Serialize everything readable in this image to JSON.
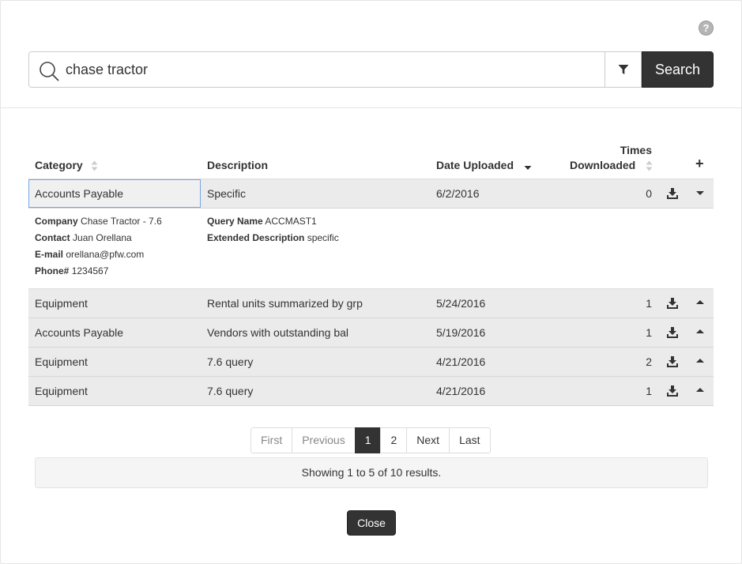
{
  "help": {
    "label": "?"
  },
  "search": {
    "value": "chase tractor",
    "button_label": "Search"
  },
  "table": {
    "headers": {
      "category": "Category",
      "description": "Description",
      "date_uploaded": "Date Uploaded",
      "times_line1": "Times",
      "times_line2": "Downloaded",
      "add": "+"
    },
    "rows": [
      {
        "category": "Accounts Payable",
        "description": "Specific",
        "date": "6/2/2016",
        "times": "0",
        "expanded": true
      },
      {
        "category": "Equipment",
        "description": "Rental units summarized by grp",
        "date": "5/24/2016",
        "times": "1",
        "expanded": false
      },
      {
        "category": "Accounts Payable",
        "description": "Vendors with outstanding bal",
        "date": "5/19/2016",
        "times": "1",
        "expanded": false
      },
      {
        "category": "Equipment",
        "description": "7.6 query",
        "date": "4/21/2016",
        "times": "2",
        "expanded": false
      },
      {
        "category": "Equipment",
        "description": "7.6 query",
        "date": "4/21/2016",
        "times": "1",
        "expanded": false
      }
    ],
    "detail": {
      "company_label": "Company",
      "company": "Chase Tractor - 7.6",
      "contact_label": "Contact",
      "contact": "Juan Orellana",
      "email_label": "E-mail",
      "email": "orellana@pfw.com",
      "phone_label": "Phone#",
      "phone": "1234567",
      "query_name_label": "Query Name",
      "query_name": "ACCMAST1",
      "ext_desc_label": "Extended Description",
      "ext_desc": "specific"
    }
  },
  "pagination": {
    "items": [
      {
        "label": "First",
        "state": "disabled"
      },
      {
        "label": "Previous",
        "state": "disabled"
      },
      {
        "label": "1",
        "state": "active"
      },
      {
        "label": "2",
        "state": "normal"
      },
      {
        "label": "Next",
        "state": "normal"
      },
      {
        "label": "Last",
        "state": "normal"
      }
    ],
    "summary": "Showing 1 to 5 of 10 results."
  },
  "footer": {
    "close_label": "Close"
  },
  "colors": {
    "dark_button": "#333333",
    "row_bg": "#ebebeb",
    "selected_border": "#76a6e8"
  }
}
